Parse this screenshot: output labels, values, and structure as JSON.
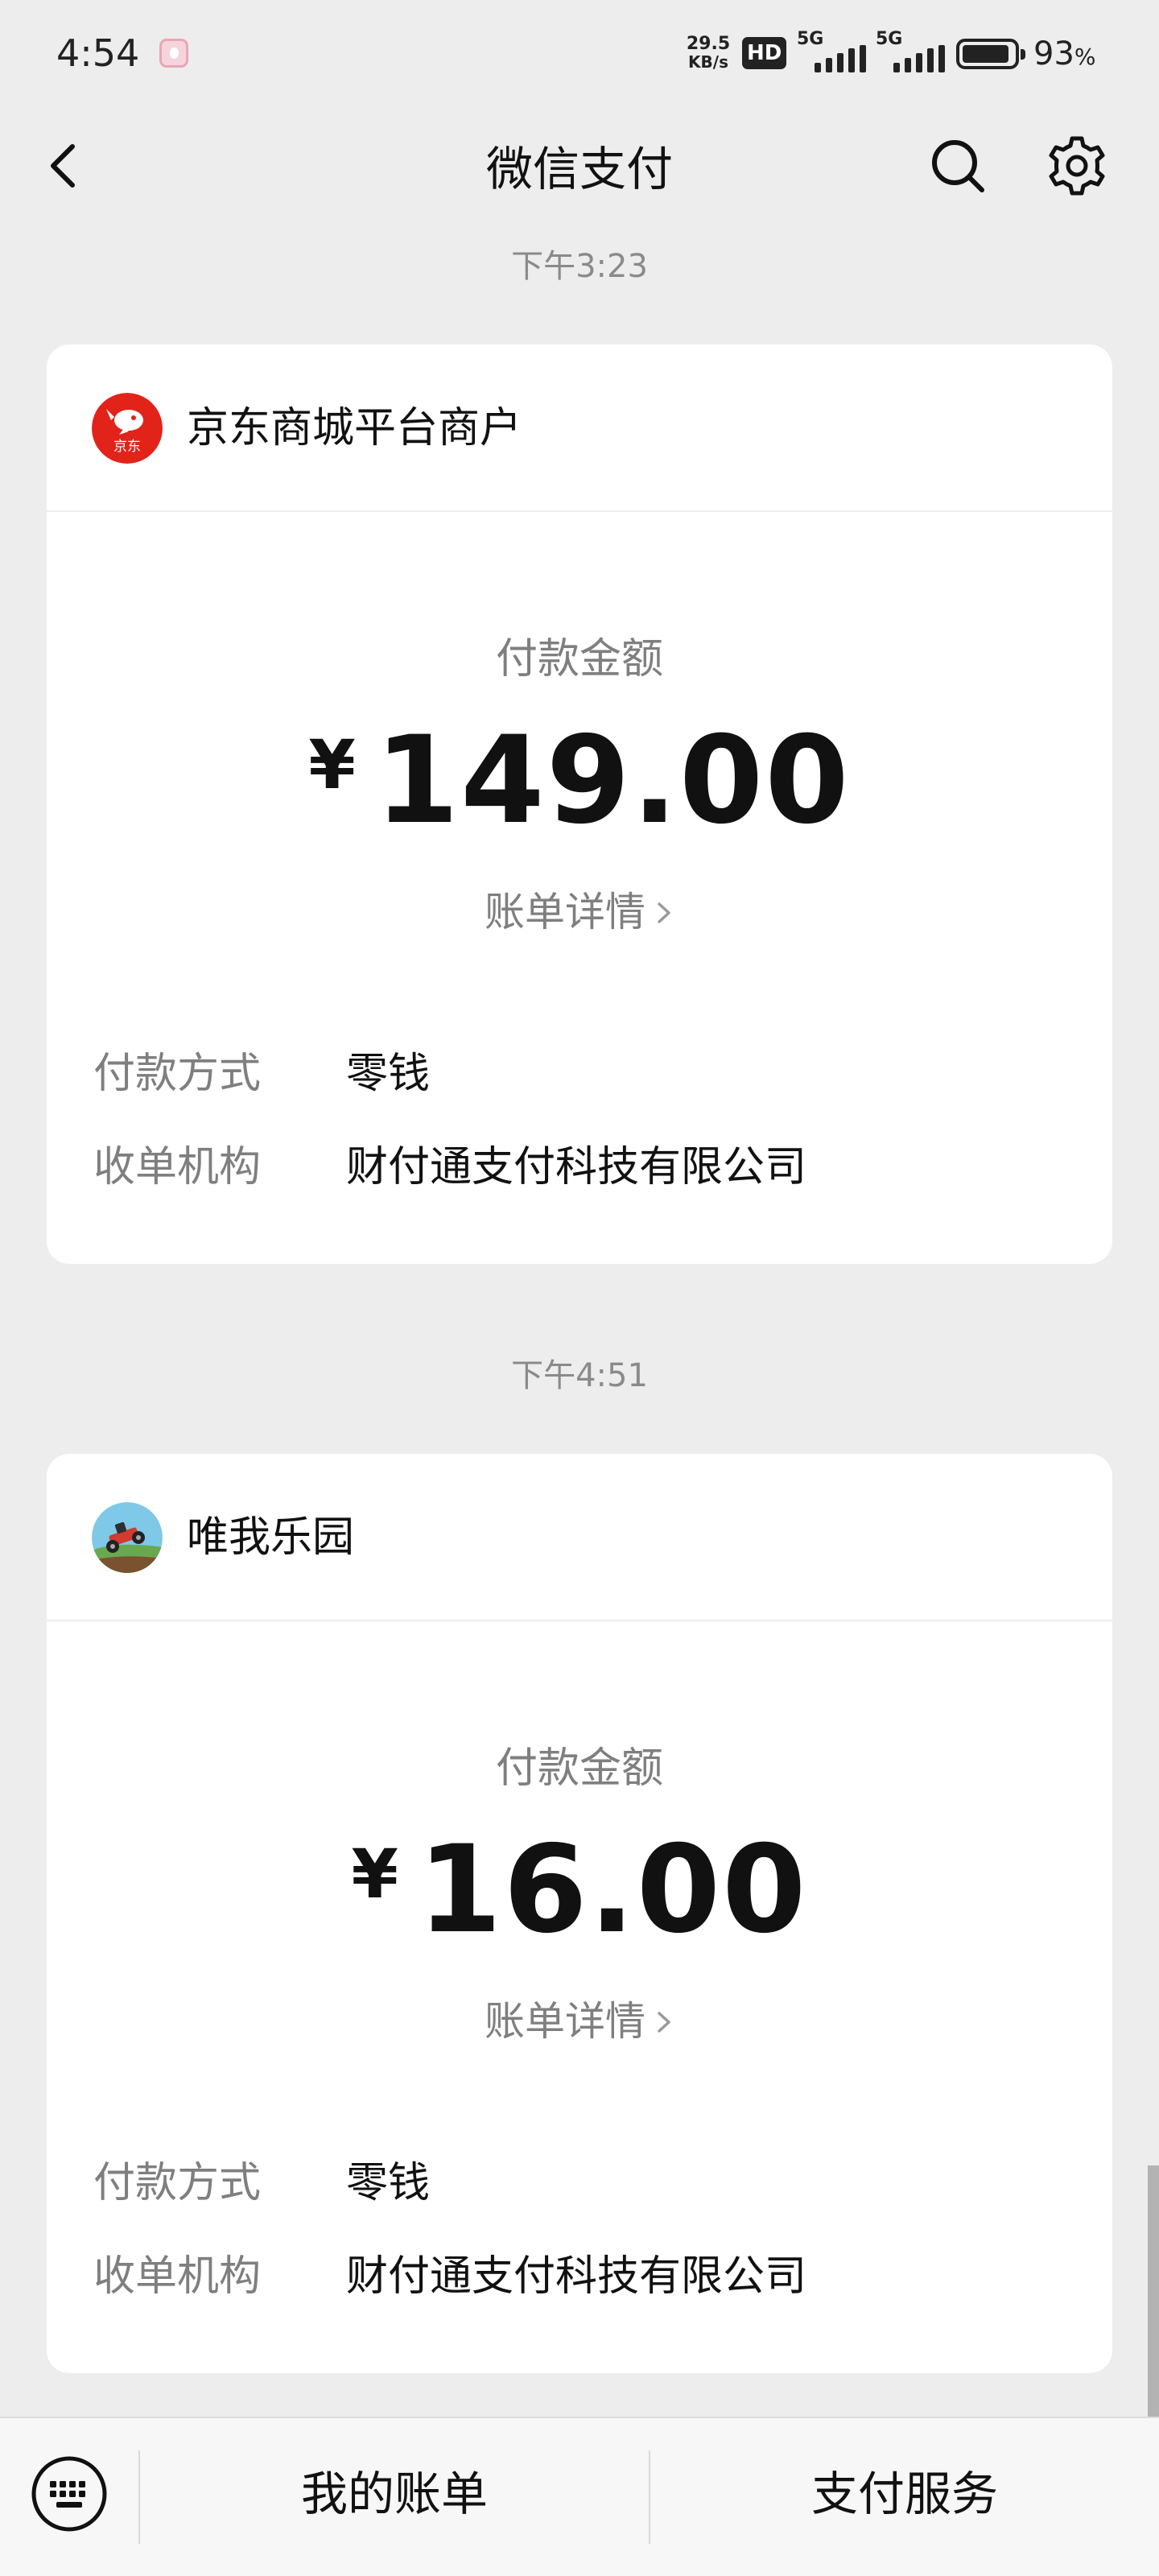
{
  "status_bar": {
    "time": "4:54",
    "net_speed_value": "29.5",
    "net_speed_unit": "KB/s",
    "hd_label": "HD",
    "signal_1": "5G",
    "signal_2": "5G",
    "battery_percent": "93",
    "battery_unit": "%",
    "battery_level": 0.93
  },
  "nav": {
    "title": "微信支付",
    "back_icon": "chevron-left-icon",
    "search_icon": "search-icon",
    "settings_icon": "gear-icon"
  },
  "messages": [
    {
      "timestamp": "下午3:23",
      "merchant": "京东商城平台商户",
      "logo_icon": "jd-logo",
      "logo_text": "京东",
      "amount_label": "付款金额",
      "currency": "¥",
      "amount": "149.00",
      "bill_detail": "账单详情",
      "details": [
        {
          "label": "付款方式",
          "value": "零钱"
        },
        {
          "label": "收单机构",
          "value": "财付通支付科技有限公司"
        }
      ]
    },
    {
      "timestamp": "下午4:51",
      "merchant": "唯我乐园",
      "logo_icon": "game-car-logo",
      "amount_label": "付款金额",
      "currency": "¥",
      "amount": "16.00",
      "bill_detail": "账单详情",
      "details": [
        {
          "label": "付款方式",
          "value": "零钱"
        },
        {
          "label": "收单机构",
          "value": "财付通支付科技有限公司"
        }
      ]
    }
  ],
  "bottom_bar": {
    "keyboard_icon": "keyboard-icon",
    "my_bills": "我的账单",
    "payment_services": "支付服务"
  },
  "colors": {
    "page_background": "#ededed",
    "card_background": "#ffffff",
    "secondary_text": "#7f7f7f",
    "jd_red": "#e2231a"
  }
}
